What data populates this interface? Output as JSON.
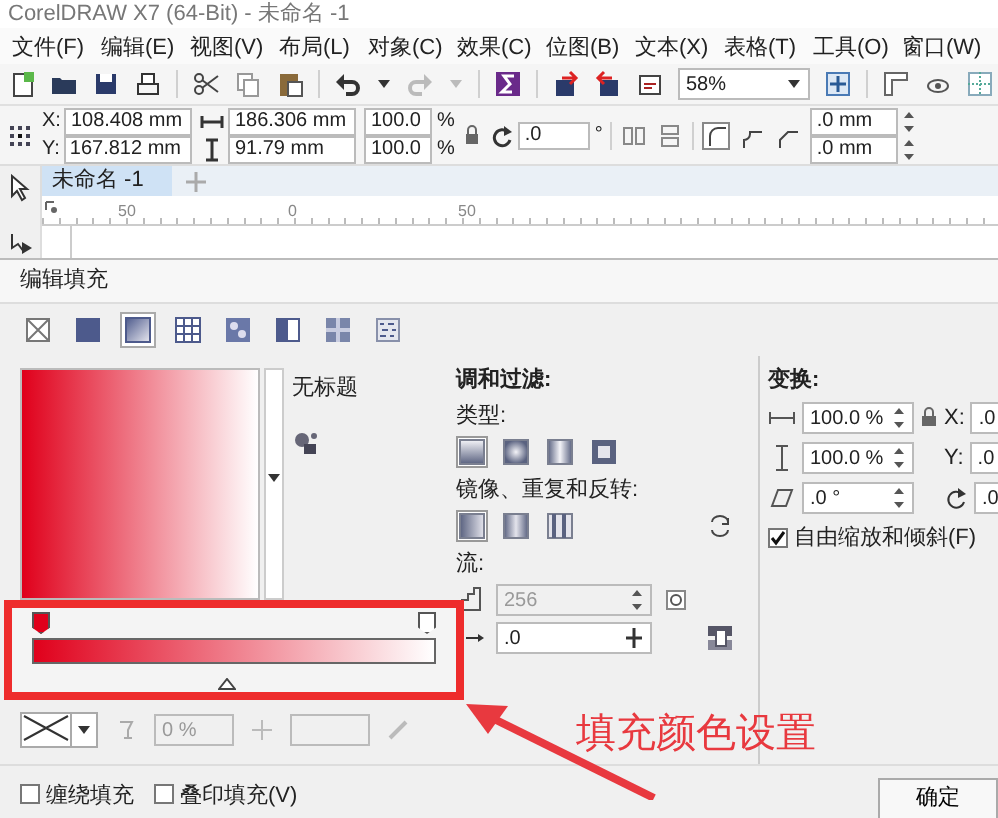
{
  "window": {
    "title": "CorelDRAW X7 (64-Bit) - 未命名 -1"
  },
  "menu": [
    "文件(F)",
    "编辑(E)",
    "视图(V)",
    "布局(L)",
    "对象(C)",
    "效果(C)",
    "位图(B)",
    "文本(X)",
    "表格(T)",
    "工具(O)",
    "窗口(W)"
  ],
  "toolbar": {
    "zoom": "58%"
  },
  "property_bar": {
    "position": [
      {
        "label": "X:",
        "value": "108.408 mm"
      },
      {
        "label": "Y:",
        "value": "167.812 mm"
      }
    ],
    "size": [
      {
        "value": "186.306 mm"
      },
      {
        "value": "91.79 mm"
      }
    ],
    "scale": [
      {
        "value": "100.0",
        "unit": "%"
      },
      {
        "value": "100.0",
        "unit": "%"
      }
    ],
    "rotation": {
      "value": ".0",
      "unit": "°"
    },
    "corner_radius": [
      {
        "value": ".0 mm"
      },
      {
        "value": ".0 mm"
      }
    ]
  },
  "document_tabs": [
    {
      "label": "未命名 -1",
      "selected": true
    }
  ],
  "ruler": [
    "50",
    "0",
    "50"
  ],
  "dialog": {
    "title": "编辑填充",
    "fill_types": [
      {
        "kind": "none",
        "selected": false
      },
      {
        "kind": "uniform",
        "selected": false
      },
      {
        "kind": "fountain",
        "selected": true
      },
      {
        "kind": "vector",
        "selected": false
      },
      {
        "kind": "bitmap",
        "selected": false
      },
      {
        "kind": "two-color",
        "selected": false
      },
      {
        "kind": "pattern",
        "selected": false
      },
      {
        "kind": "texture",
        "selected": false
      }
    ],
    "preview_name": "无标题",
    "gradient": {
      "stops": [
        {
          "color": "#e0001b"
        },
        {
          "color": "#ffffff"
        }
      ],
      "midpoint": {
        "level": 0.5
      }
    },
    "stop_controls": {
      "transparency": "0 %"
    },
    "blend": {
      "heading": "调和过滤:",
      "type_label": "类型:",
      "types": [
        {
          "kind": "linear",
          "selected": true
        },
        {
          "kind": "elliptical",
          "selected": false
        },
        {
          "kind": "conical",
          "selected": false
        },
        {
          "kind": "rectangular",
          "selected": false
        }
      ],
      "mirror_label": "镜像、重复和反转:",
      "mirror_options": [
        {
          "kind": "default",
          "selected": true
        },
        {
          "kind": "mirror",
          "selected": false
        },
        {
          "kind": "repeat",
          "selected": false
        }
      ],
      "flow_label": "流:",
      "steps": {
        "value": "256",
        "disabled": true
      },
      "acceleration": ".0"
    },
    "transform": {
      "heading": "变换:",
      "fields": [
        {
          "kind": "width",
          "value": "100.0 %"
        },
        {
          "kind": "height",
          "value": "100.0 %"
        },
        {
          "kind": "skew",
          "value": ".0 °"
        }
      ],
      "offsets": [
        {
          "label": "X:",
          "value": ".0"
        },
        {
          "label": "Y:",
          "value": ".0"
        },
        {
          "value": ".0"
        }
      ],
      "free_scale": {
        "label": "自由缩放和倾斜(F)",
        "checked": true
      }
    },
    "checkboxes": [
      {
        "label": "缠绕填充",
        "checked": false
      },
      {
        "label": "叠印填充(V)",
        "checked": false
      }
    ],
    "ok_button": "确定"
  },
  "annotation": {
    "text": "填充颜色设置"
  }
}
